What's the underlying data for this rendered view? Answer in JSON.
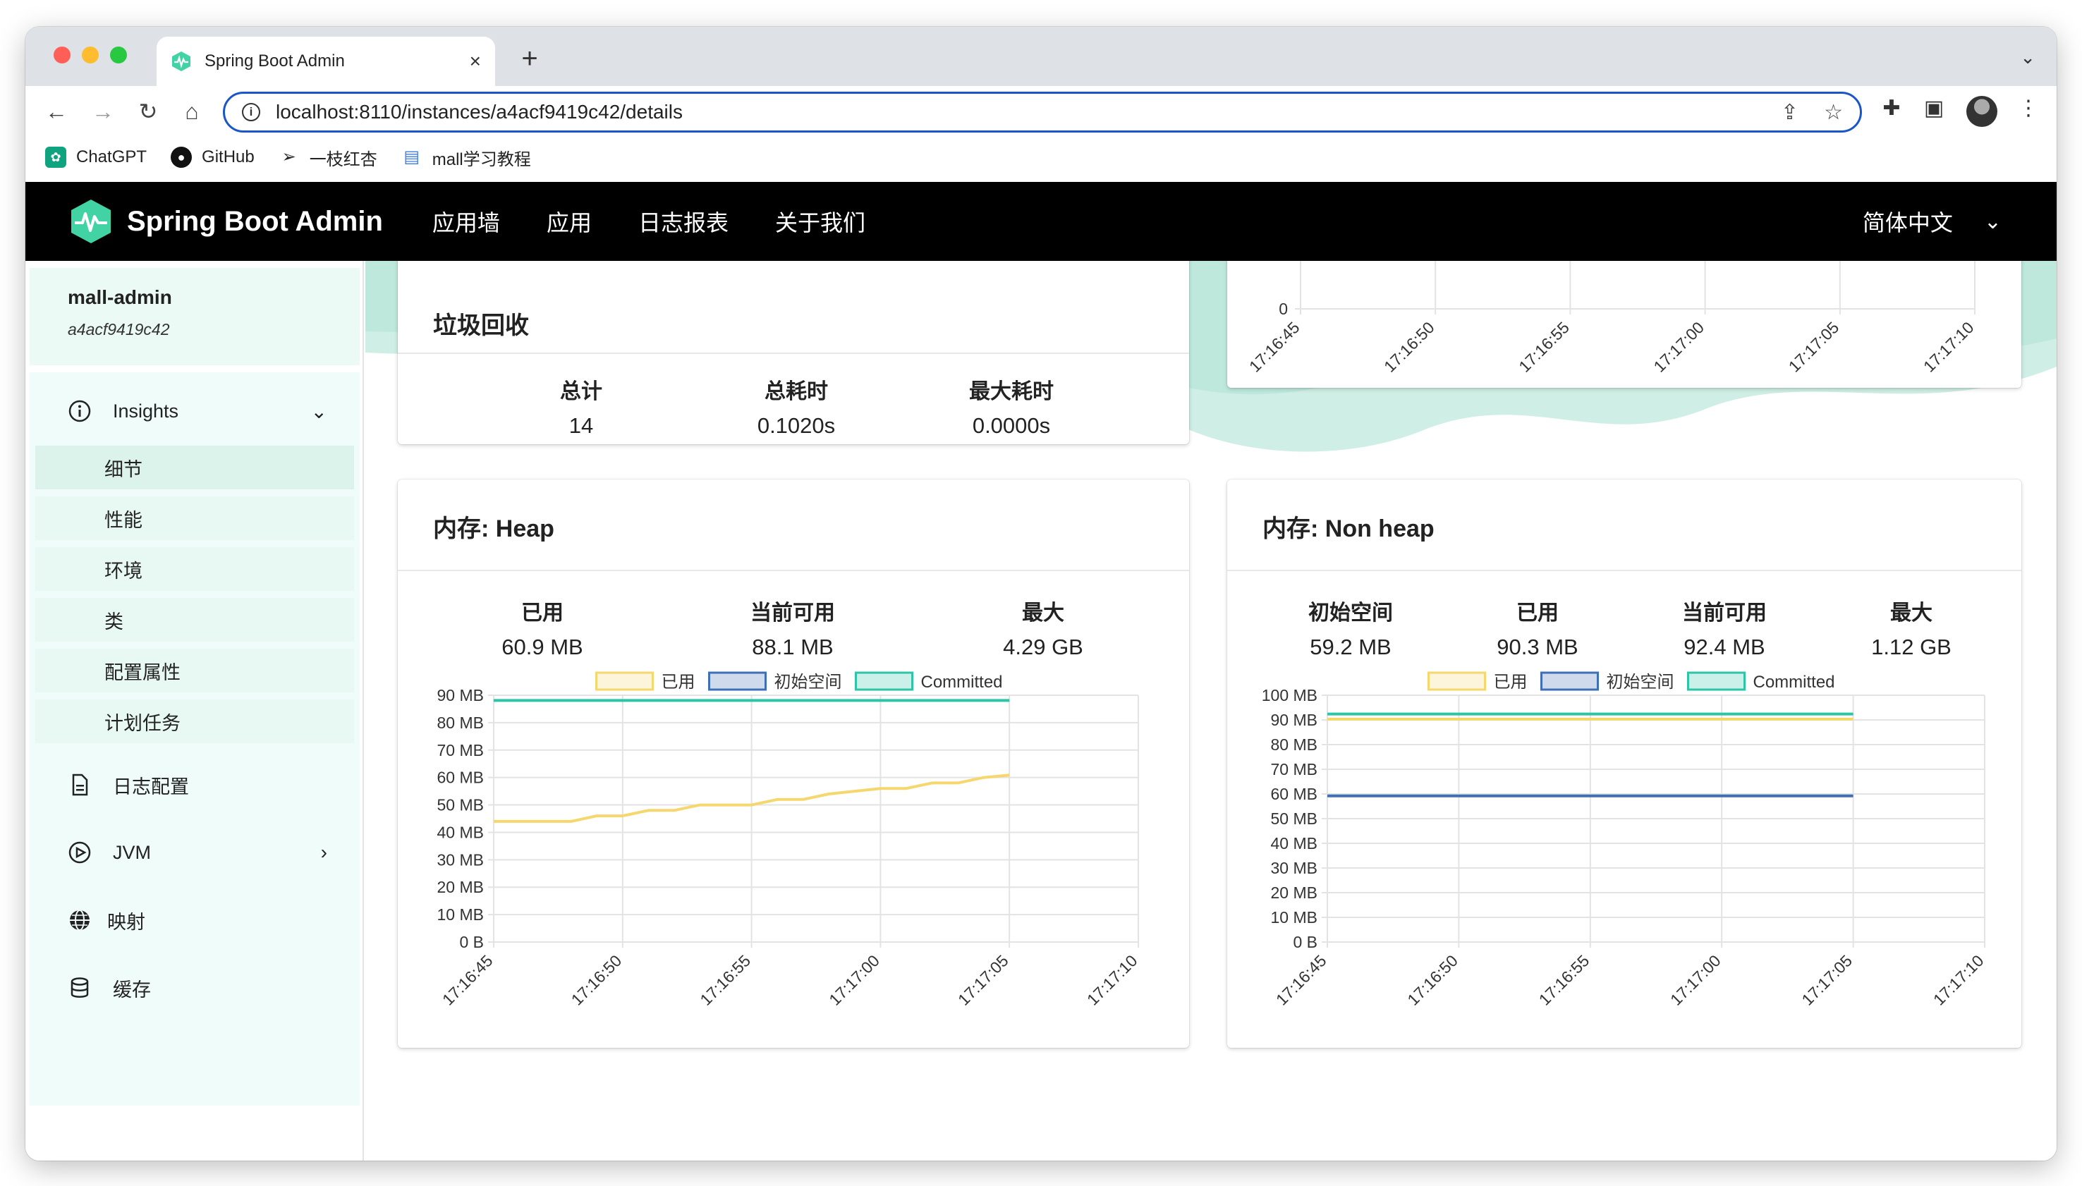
{
  "browser": {
    "tab_title": "Spring Boot Admin",
    "url": "localhost:8110/instances/a4acf9419c42/details",
    "bookmarks": [
      "ChatGPT",
      "GitHub",
      "一枝红杏",
      "mall学习教程"
    ]
  },
  "nav": {
    "brand": "Spring Boot Admin",
    "items": [
      "应用墙",
      "应用",
      "日志报表",
      "关于我们"
    ],
    "language": "简体中文"
  },
  "sidebar": {
    "app_name": "mall-admin",
    "instance_id": "a4acf9419c42",
    "insights_label": "Insights",
    "insights_items": [
      "细节",
      "性能",
      "环境",
      "类",
      "配置属性",
      "计划任务"
    ],
    "log_config": "日志配置",
    "jvm": "JVM",
    "mappings": "映射",
    "cache": "缓存"
  },
  "gc": {
    "title": "垃圾回收",
    "stats": [
      {
        "label": "总计",
        "value": "14"
      },
      {
        "label": "总耗时",
        "value": "0.1020s"
      },
      {
        "label": "最大耗时",
        "value": "0.0000s"
      }
    ]
  },
  "top_chart": {
    "y_tick": "0",
    "x_ticks": [
      "17:16:45",
      "17:16:50",
      "17:16:55",
      "17:17:00",
      "17:17:05",
      "17:17:10"
    ]
  },
  "heap": {
    "title": "内存: Heap",
    "stats": [
      {
        "label": "已用",
        "value": "60.9 MB"
      },
      {
        "label": "当前可用",
        "value": "88.1 MB"
      },
      {
        "label": "最大",
        "value": "4.29 GB"
      }
    ]
  },
  "nonheap": {
    "title": "内存: Non heap",
    "stats": [
      {
        "label": "初始空间",
        "value": "59.2 MB"
      },
      {
        "label": "已用",
        "value": "90.3 MB"
      },
      {
        "label": "当前可用",
        "value": "92.4 MB"
      },
      {
        "label": "最大",
        "value": "1.12 GB"
      }
    ]
  },
  "colors": {
    "used": "#f5d76e",
    "init": "#3f6fb5",
    "committed": "#2ec4a6",
    "brand": "#42d3a5"
  },
  "chart_data": [
    {
      "type": "line",
      "title": "内存: Heap",
      "x": [
        "17:16:45",
        "17:16:46",
        "17:16:47",
        "17:16:48",
        "17:16:49",
        "17:16:50",
        "17:16:51",
        "17:16:52",
        "17:16:53",
        "17:16:54",
        "17:16:55",
        "17:16:56",
        "17:16:57",
        "17:16:58",
        "17:16:59",
        "17:17:00",
        "17:17:01",
        "17:17:02",
        "17:17:03",
        "17:17:04",
        "17:17:05"
      ],
      "x_ticks": [
        "17:16:45",
        "17:16:50",
        "17:16:55",
        "17:17:00",
        "17:17:05",
        "17:17:10"
      ],
      "y_ticks": [
        "0 B",
        "10 MB",
        "20 MB",
        "30 MB",
        "40 MB",
        "50 MB",
        "60 MB",
        "70 MB",
        "80 MB",
        "90 MB"
      ],
      "ylim": [
        0,
        90
      ],
      "grid": true,
      "legend": "top-center",
      "series": [
        {
          "name": "已用",
          "values": [
            44,
            44,
            44,
            44,
            46,
            46,
            48,
            48,
            50,
            50,
            50,
            52,
            52,
            54,
            55,
            56,
            56,
            58,
            58,
            60,
            60.9
          ]
        },
        {
          "name": "Committed",
          "values": [
            88.1,
            88.1,
            88.1,
            88.1,
            88.1,
            88.1,
            88.1,
            88.1,
            88.1,
            88.1,
            88.1,
            88.1,
            88.1,
            88.1,
            88.1,
            88.1,
            88.1,
            88.1,
            88.1,
            88.1,
            88.1
          ]
        }
      ],
      "legend_entries": [
        "已用",
        "初始空间",
        "Committed"
      ]
    },
    {
      "type": "line",
      "title": "内存: Non heap",
      "x": [
        "17:16:45",
        "17:17:05"
      ],
      "x_ticks": [
        "17:16:45",
        "17:16:50",
        "17:16:55",
        "17:17:00",
        "17:17:05",
        "17:17:10"
      ],
      "y_ticks": [
        "0 B",
        "10 MB",
        "20 MB",
        "30 MB",
        "40 MB",
        "50 MB",
        "60 MB",
        "70 MB",
        "80 MB",
        "90 MB",
        "100 MB"
      ],
      "ylim": [
        0,
        100
      ],
      "grid": true,
      "legend": "top-center",
      "series": [
        {
          "name": "已用",
          "values": [
            90.3,
            90.3
          ]
        },
        {
          "name": "初始空间",
          "values": [
            59.2,
            59.2
          ]
        },
        {
          "name": "Committed",
          "values": [
            92.4,
            92.4
          ]
        }
      ],
      "legend_entries": [
        "已用",
        "初始空间",
        "Committed"
      ]
    }
  ]
}
